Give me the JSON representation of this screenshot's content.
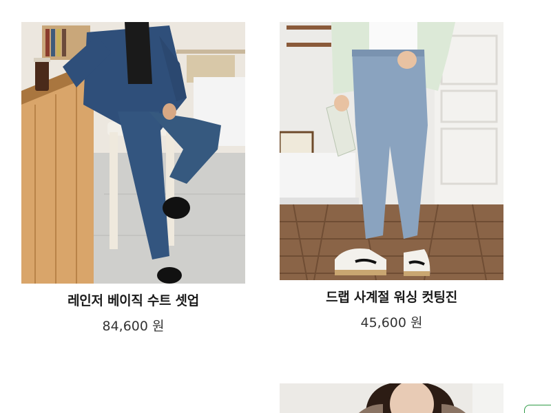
{
  "products": [
    {
      "name": "레인저 베이직 수트 셋업",
      "price": "84,600 원",
      "image_icon": "suit-setup-photo"
    },
    {
      "name": "드랩 사계절 워싱 컷팅진",
      "price": "45,600 원",
      "image_icon": "washed-jeans-photo"
    },
    {
      "name": "",
      "price": "",
      "image_icon": "coat-photo"
    }
  ],
  "colors": {
    "accent_green": "#2e9a46",
    "text_dark": "#1a1a1a",
    "price_text": "#333333"
  }
}
